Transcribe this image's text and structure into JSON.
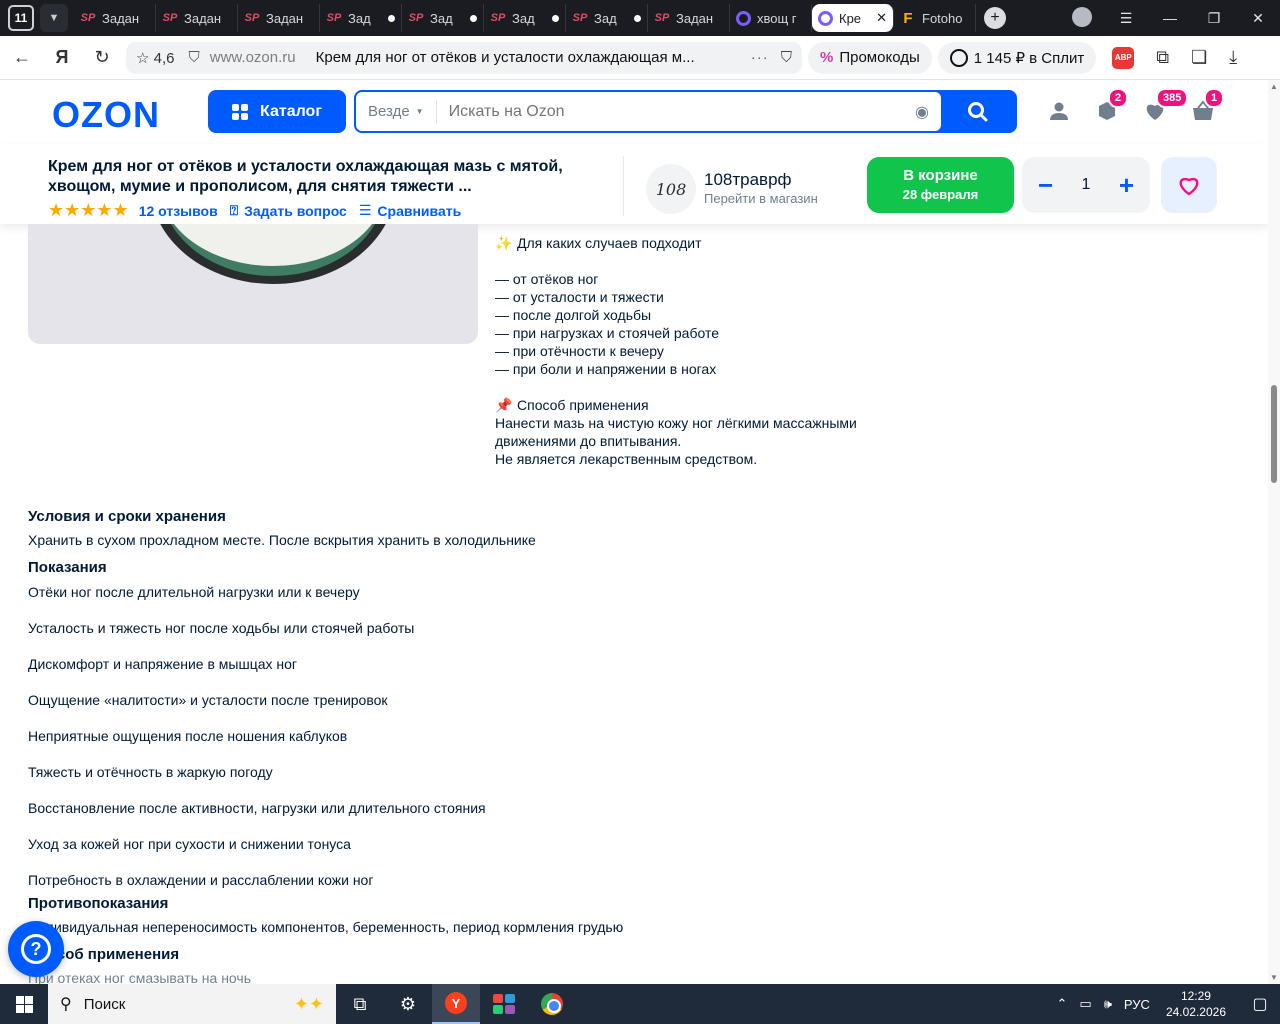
{
  "browser": {
    "tab_count": "11",
    "tabs": [
      {
        "icon": "sp",
        "title": "Задан",
        "dot": false
      },
      {
        "icon": "sp",
        "title": "Задан",
        "dot": false
      },
      {
        "icon": "sp",
        "title": "Задан",
        "dot": false
      },
      {
        "icon": "sp",
        "title": "Зад",
        "dot": true
      },
      {
        "icon": "sp",
        "title": "Зад",
        "dot": true
      },
      {
        "icon": "sp",
        "title": "Зад",
        "dot": true
      },
      {
        "icon": "sp",
        "title": "Зад",
        "dot": true
      },
      {
        "icon": "sp",
        "title": "Задан",
        "dot": false
      },
      {
        "icon": "oz",
        "title": "хвощ г",
        "dot": false
      },
      {
        "icon": "oz",
        "title": "Кре",
        "dot": false,
        "active": true
      },
      {
        "icon": "ff",
        "title": "Fotoho",
        "dot": false
      }
    ],
    "rating": "4,6",
    "domain": "www.ozon.ru",
    "page_title": "Крем для ног от отёков и усталости охлаждающая м...",
    "promo_label": "Промокоды",
    "split_label": "1 145 ₽ в Сплит",
    "abp_label": "ABP"
  },
  "header": {
    "logo": "OZON",
    "catalog_label": "Каталог",
    "search_scope": "Везде",
    "search_placeholder": "Искать на Ozon",
    "badges": {
      "orders": "2",
      "favorites": "385",
      "cart": "1"
    }
  },
  "sticky": {
    "title": "Крем для ног от отёков и усталости охлаждающая мазь с мятой, хвощом, мумие и прополисом, для снятия тяжести ...",
    "stars": "★★★★★",
    "reviews": "12 отзывов",
    "ask": "Задать вопрос",
    "compare": "Сравнивать",
    "seller_logo_text": "108",
    "seller_name": "108траврф",
    "seller_link": "Перейти в магазин",
    "cart_line1": "В корзине",
    "cart_line2": "28 февраля",
    "qty": "1",
    "minus": "−",
    "plus": "+"
  },
  "description": {
    "occasions_title": "Для каких случаев подходит",
    "occasions": [
      "— от отёков ног",
      "— от усталости и тяжести",
      "— после долгой ходьбы",
      "— при нагрузках и стоячей работе",
      "— при отёчности к вечеру",
      "— при боли и напряжении в ногах"
    ],
    "usage_title": "Способ применения",
    "usage_lines": [
      "Нанести мазь на чистую кожу ног лёгкими массажными",
      "движениями до впитывания.",
      "Не является лекарственным средством."
    ]
  },
  "specs": {
    "storage_title": "Условия и сроки хранения",
    "storage_text": "Хранить в сухом прохладном месте. После вскрытия хранить в холодильнике",
    "indications_title": "Показания",
    "indications": [
      "Отёки ног после длительной нагрузки или к вечеру",
      "Усталость и тяжесть ног после ходьбы или стоячей работы",
      "Дискомфорт и напряжение в мышцах ног",
      "Ощущение «налитости» и усталости после тренировок",
      "Неприятные ощущения после ношения каблуков",
      "Тяжесть и отёчность в жаркую погоду",
      "Восстановление после активности, нагрузки или длительного стояния",
      "Уход за кожей ног при сухости и снижении тонуса",
      "Потребность в охлаждении и расслаблении кожи ног"
    ],
    "contra_title": "Противопоказания",
    "contra_text": "Индивидуальная непереносимость компонентов, беременность, период кормления грудью",
    "method_title": "Способ применения",
    "method_text": "При отеках ног смазывать на ночь"
  },
  "taskbar": {
    "search_label": "Поиск",
    "lang": "РУС",
    "time": "12:29",
    "date": "24.02.2026"
  },
  "colors": {
    "ozon_blue": "#005bff",
    "cart_green": "#10c44c",
    "badge_pink": "#f1117e",
    "star_orange": "#ffa800"
  }
}
